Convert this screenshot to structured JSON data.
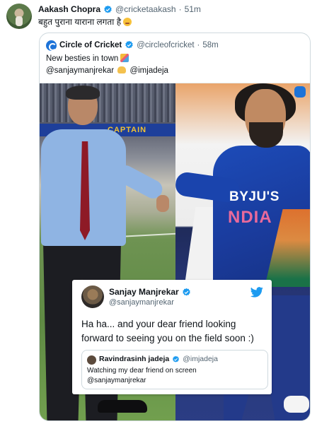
{
  "tweet": {
    "author_name": "Aakash Chopra",
    "author_handle": "@cricketaakash",
    "separator": "·",
    "time": "51m",
    "text": "बहुत पुराना याराना लगता है",
    "emoji_icon": "blushing-face-emoji-icon"
  },
  "quoted": {
    "author_name": "Circle of Cricket",
    "author_handle": "@circleofcricket",
    "separator": "·",
    "time": "58m",
    "line1": "New besties in town",
    "line1_emoji": "party-face-emoji-icon",
    "line2_mention1": "@sanjaymanjrekar",
    "line2_emoji": "handshake-emoji-icon",
    "line2_mention2": "@imjadeja"
  },
  "photo": {
    "board_text": "CAPTAIN",
    "jersey_sponsor": "BYJU'S",
    "jersey_country": "NDIA"
  },
  "screenshot_card": {
    "author_name": "Sanjay Manjrekar",
    "author_handle": "@sanjaymanjrekar",
    "text_line1": "Ha ha... and your dear friend looking",
    "text_line2": "forward to seeing you on the field soon :)",
    "brand_icon": "twitter-bird-icon",
    "inner": {
      "author_name": "Ravindrasinh jadeja",
      "author_handle": "@imjadeja",
      "text_line1": "Watching my dear friend on screen",
      "text_line2": "@sanjaymanjrekar"
    }
  },
  "colors": {
    "verified_blue": "#1d9bf0",
    "text_primary": "#0f1419",
    "text_secondary": "#536471",
    "border": "#cfd9de"
  }
}
